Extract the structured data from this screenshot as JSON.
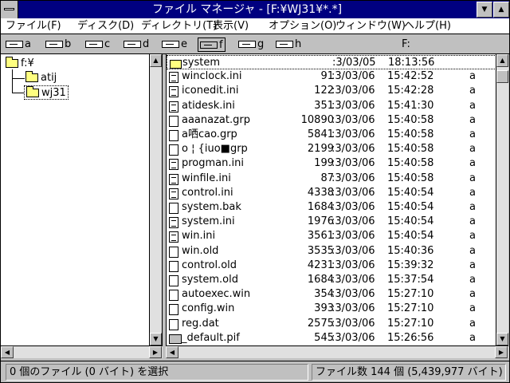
{
  "title": "ファイル マネージャ - [F:¥WJ31¥*.*]",
  "window_buttons": {
    "minimize": "▼",
    "maximize": "▲"
  },
  "menu": [
    "ファイル(F)",
    "ディスク(D)",
    "ディレクトリ(T)",
    "表示(V)",
    "オプション(O)",
    "ウィンドウ(W)",
    "ヘルプ(H)"
  ],
  "drives": [
    "a",
    "b",
    "c",
    "d",
    "e",
    "f",
    "g",
    "h"
  ],
  "selected_drive": "f",
  "current_drive_label": "F:",
  "tree": {
    "root": "f:¥",
    "children": [
      "atij",
      "wj31"
    ],
    "selected": "wj31"
  },
  "files": [
    {
      "name": "system",
      "size": "",
      "date": ":3/03/05",
      "time": "18:13:56",
      "attr": "",
      "icon": "folder-icon"
    },
    {
      "name": "winclock.ini",
      "size": "91",
      "date": ":3/03/06",
      "time": "15:42:52",
      "attr": "a",
      "icon": "document-icon"
    },
    {
      "name": "iconedit.ini",
      "size": "122",
      "date": ":3/03/06",
      "time": "15:42:28",
      "attr": "a",
      "icon": "document-icon"
    },
    {
      "name": "atidesk.ini",
      "size": "351",
      "date": ":3/03/06",
      "time": "15:41:30",
      "attr": "a",
      "icon": "document-icon"
    },
    {
      "name": "aaanazat.grp",
      "size": "10890",
      "date": ":3/03/06",
      "time": "15:40:58",
      "attr": "a",
      "icon": "file-icon"
    },
    {
      "name": "a哂cao.grp",
      "size": "5841",
      "date": ":3/03/06",
      "time": "15:40:58",
      "attr": "a",
      "icon": "file-icon"
    },
    {
      "name": "o ¦ {iuo■grp",
      "size": "2199",
      "date": ":3/03/06",
      "time": "15:40:58",
      "attr": "a",
      "icon": "file-icon"
    },
    {
      "name": "progman.ini",
      "size": "199",
      "date": ":3/03/06",
      "time": "15:40:58",
      "attr": "a",
      "icon": "document-icon"
    },
    {
      "name": "winfile.ini",
      "size": "87",
      "date": ":3/03/06",
      "time": "15:40:58",
      "attr": "a",
      "icon": "document-icon"
    },
    {
      "name": "control.ini",
      "size": "4338",
      "date": ":3/03/06",
      "time": "15:40:54",
      "attr": "a",
      "icon": "document-icon"
    },
    {
      "name": "system.bak",
      "size": "1684",
      "date": ":3/03/06",
      "time": "15:40:54",
      "attr": "a",
      "icon": "file-icon"
    },
    {
      "name": "system.ini",
      "size": "1976",
      "date": ":3/03/06",
      "time": "15:40:54",
      "attr": "a",
      "icon": "document-icon"
    },
    {
      "name": "win.ini",
      "size": "3561",
      "date": ":3/03/06",
      "time": "15:40:54",
      "attr": "a",
      "icon": "document-icon"
    },
    {
      "name": "win.old",
      "size": "3535",
      "date": ":3/03/06",
      "time": "15:40:36",
      "attr": "a",
      "icon": "file-icon"
    },
    {
      "name": "control.old",
      "size": "4231",
      "date": ":3/03/06",
      "time": "15:39:32",
      "attr": "a",
      "icon": "file-icon"
    },
    {
      "name": "system.old",
      "size": "1684",
      "date": ":3/03/06",
      "time": "15:37:54",
      "attr": "a",
      "icon": "file-icon"
    },
    {
      "name": "autoexec.win",
      "size": "354",
      "date": ":3/03/06",
      "time": "15:27:10",
      "attr": "a",
      "icon": "file-icon"
    },
    {
      "name": "config.win",
      "size": "393",
      "date": ":3/03/06",
      "time": "15:27:10",
      "attr": "a",
      "icon": "file-icon"
    },
    {
      "name": "reg.dat",
      "size": "2575",
      "date": ":3/03/06",
      "time": "15:27:10",
      "attr": "a",
      "icon": "file-icon"
    },
    {
      "name": "_default.pif",
      "size": "545",
      "date": ":3/03/06",
      "time": "15:26:56",
      "attr": "a",
      "icon": "pif-icon"
    }
  ],
  "status": {
    "selection": "0 個のファイル (0 バイト) を選択",
    "total": "ファイル数 144 個 (5,439,977 バイト)"
  }
}
